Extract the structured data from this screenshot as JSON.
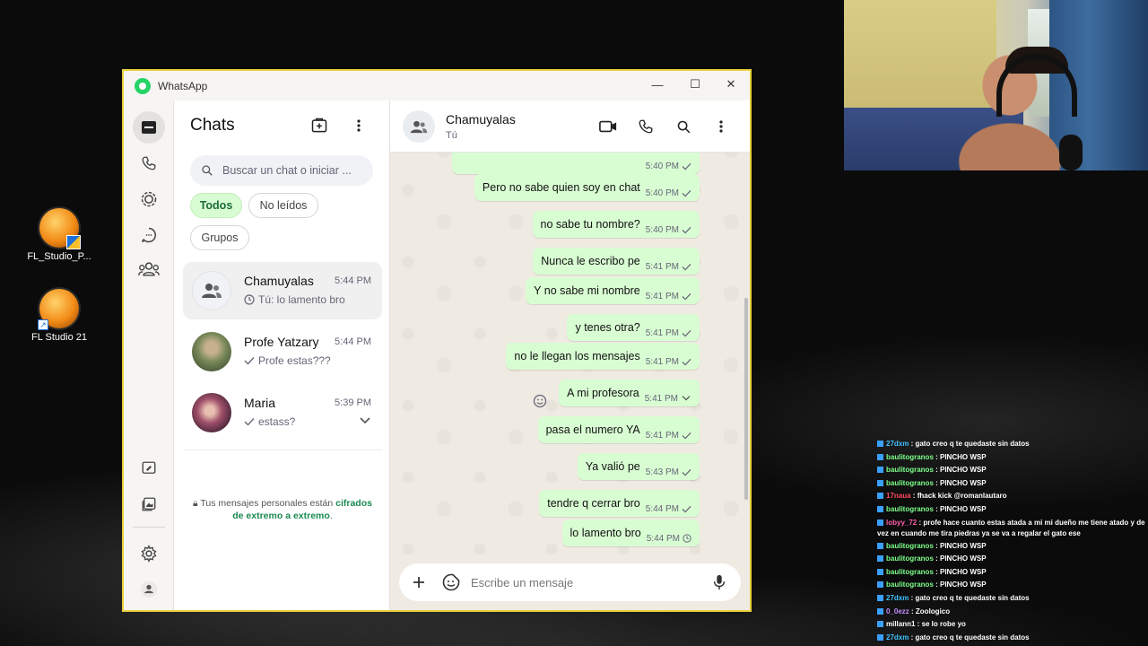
{
  "desktop": {
    "icons": [
      {
        "label": "FL_Studio_P..."
      },
      {
        "label": "FL Studio 21"
      }
    ]
  },
  "stream_chat": {
    "messages": [
      {
        "user": "27dxm",
        "text": "gato creo q te quedaste sin datos",
        "color": "#3fc1ff"
      },
      {
        "user": "baulitogranos",
        "text": "PINCHO WSP",
        "color": "#7cff8a"
      },
      {
        "user": "baulitogranos",
        "text": "PINCHO WSP",
        "color": "#7cff8a"
      },
      {
        "user": "baulitogranos",
        "text": "PINCHO WSP",
        "color": "#7cff8a"
      },
      {
        "user": "17naua",
        "text": "fhack kick @romanlautaro",
        "color": "#ff4a5c"
      },
      {
        "user": "baulitogranos",
        "text": "PINCHO WSP",
        "color": "#7cff8a"
      },
      {
        "user": "lobyy_72",
        "text": "profe hace cuanto estas atada a mi mi dueño me tiene atado y de vez en cuando me tira piedras ya se va a regalar el gato ese",
        "color": "#ff5fa8"
      },
      {
        "user": "baulitogranos",
        "text": "PINCHO WSP",
        "color": "#7cff8a"
      },
      {
        "user": "baulitogranos",
        "text": "PINCHO WSP",
        "color": "#7cff8a"
      },
      {
        "user": "baulitogranos",
        "text": "PINCHO WSP",
        "color": "#7cff8a"
      },
      {
        "user": "baulitogranos",
        "text": "PINCHO WSP",
        "color": "#7cff8a"
      },
      {
        "user": "27dxm",
        "text": "gato creo q te quedaste sin datos",
        "color": "#3fc1ff"
      },
      {
        "user": "0_0ezz",
        "text": "Zoologico",
        "color": "#c48cff"
      },
      {
        "user": "millann1",
        "text": "se lo robe yo",
        "color": "#ffffff"
      },
      {
        "user": "27dxm",
        "text": "gato creo q te quedaste sin datos",
        "color": "#3fc1ff"
      }
    ]
  },
  "window": {
    "title": "WhatsApp",
    "controls": {
      "minimize": "—",
      "maximize": "☐",
      "close": "✕"
    }
  },
  "sidebar": {
    "title": "Chats",
    "search_placeholder": "Buscar un chat o iniciar ...",
    "filters": [
      {
        "label": "Todos",
        "active": true
      },
      {
        "label": "No leídos",
        "active": false
      },
      {
        "label": "Grupos",
        "active": false
      }
    ],
    "chats": [
      {
        "name": "Chamuyalas",
        "time": "5:44 PM",
        "preview": "Tú: lo lamento bro",
        "status": "clock"
      },
      {
        "name": "Profe Yatzary",
        "time": "5:44 PM",
        "preview": "Profe estas???",
        "status": "check"
      },
      {
        "name": "Maria",
        "time": "5:39 PM",
        "preview": "estass?",
        "status": "check"
      }
    ],
    "encryption_note": "Tus mensajes personales están ",
    "encryption_link": "cifrados de extremo a extremo",
    "encryption_end": "."
  },
  "conversation": {
    "name": "Chamuyalas",
    "subtitle": "Tú",
    "messages": [
      {
        "text": "",
        "time": "5:40 PM",
        "status": "check"
      },
      {
        "text": "Pero no sabe quien soy en chat",
        "time": "5:40 PM",
        "status": "check"
      },
      {
        "text": "no sabe tu nombre?",
        "time": "5:40 PM",
        "status": "check"
      },
      {
        "text": "Nunca le escribo pe",
        "time": "5:41 PM",
        "status": "check"
      },
      {
        "text": "Y no sabe mi nombre",
        "time": "5:41 PM",
        "status": "check"
      },
      {
        "text": "y tenes otra?",
        "time": "5:41 PM",
        "status": "check"
      },
      {
        "text": "no le llegan los mensajes",
        "time": "5:41 PM",
        "status": "check"
      },
      {
        "text": "A mi profesora",
        "time": "5:41 PM",
        "status": "chevron"
      },
      {
        "text": "pasa el numero YA",
        "time": "5:41 PM",
        "status": "check"
      },
      {
        "text": "Ya valió pe",
        "time": "5:43 PM",
        "status": "check"
      },
      {
        "text": "tendre q cerrar bro",
        "time": "5:44 PM",
        "status": "check"
      },
      {
        "text": "lo lamento bro",
        "time": "5:44 PM",
        "status": "clock"
      }
    ],
    "composer_placeholder": "Escribe un mensaje"
  },
  "colors": {
    "accent": "#25d366",
    "bubble_out": "#d9fdd3",
    "chat_bg": "#efeae2",
    "window_border": "#e8cf3a"
  }
}
